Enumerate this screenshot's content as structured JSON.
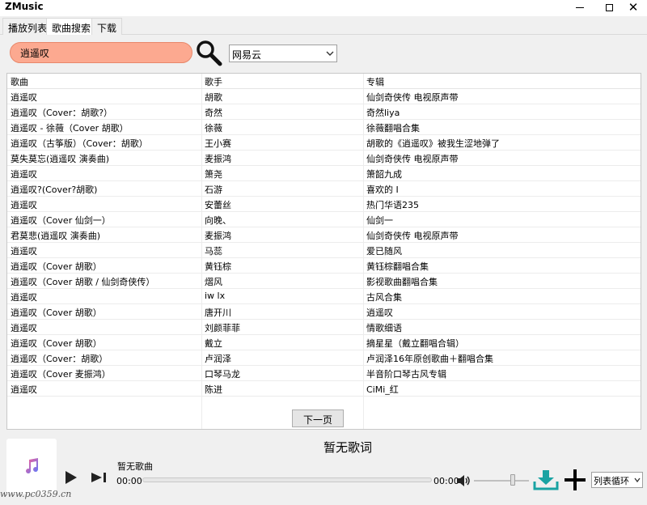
{
  "window": {
    "title": "ZMusic",
    "minimize_glyph": "—",
    "maximize_glyph": "☐",
    "close_glyph": "✕"
  },
  "tabs": [
    {
      "label": "播放列表",
      "active": false
    },
    {
      "label": "歌曲搜索",
      "active": true
    },
    {
      "label": "下载",
      "active": false
    }
  ],
  "search": {
    "value": "逍遥叹",
    "source": "网易云",
    "search_icon": "magnifier-icon"
  },
  "table": {
    "columns": [
      "歌曲",
      "歌手",
      "专辑"
    ],
    "rows": [
      [
        "逍遥叹",
        "胡歌",
        "仙剑奇侠传 电视原声带"
      ],
      [
        "逍遥叹（Cover：胡歌?）",
        "奇然",
        "奇然liya"
      ],
      [
        "逍遥叹 - 徐薇（Cover 胡歌）",
        "徐薇",
        "徐薇翻唱合集"
      ],
      [
        "逍遥叹（古筝版）（Cover：胡歌）",
        "王小赛",
        "胡歌的《逍遥叹》被我生涩地弹了"
      ],
      [
        "莫失莫忘(逍遥叹 演奏曲)",
        "麦振鸿",
        "仙剑奇侠传 电视原声带"
      ],
      [
        "逍遥叹",
        "箫尧",
        "箫韶九成"
      ],
      [
        "逍遥叹?(Cover?胡歌)",
        "石游",
        "喜欢的 I"
      ],
      [
        "逍遥叹",
        "安蕾丝",
        "热门华语235"
      ],
      [
        "逍遥叹（Cover 仙剑一）",
        "向晚、",
        "仙剑一"
      ],
      [
        "君莫悲(逍遥叹 演奏曲)",
        "麦振鸿",
        "仙剑奇侠传 电视原声带"
      ],
      [
        "逍遥叹",
        "马蕊",
        "爱已随风"
      ],
      [
        "逍遥叹（Cover 胡歌）",
        "黄钰棕",
        "黄钰棕翻唱合集"
      ],
      [
        "逍遥叹（Cover 胡歌 / 仙剑奇侠传）",
        "熠风",
        "影视歌曲翻唱合集"
      ],
      [
        "逍遥叹",
        "iw lx",
        "古风合集"
      ],
      [
        "逍遥叹（Cover 胡歌）",
        "唐开川",
        "逍遥叹"
      ],
      [
        "逍遥叹",
        "刘颜菲菲",
        "情歌细语"
      ],
      [
        "逍遥叹（Cover 胡歌）",
        "戴立",
        "摘星星（戴立翻唱合辑）"
      ],
      [
        "逍遥叹（Cover：胡歌）",
        "卢润泽",
        "卢润泽16年原创歌曲＋翻唱合集"
      ],
      [
        "逍遥叹（Cover 麦振鸿）",
        "口琴马龙",
        "半音阶口琴古风专辑"
      ],
      [
        "逍遥叹",
        "陈进",
        "CiMi_红"
      ]
    ],
    "next_page": "下一页"
  },
  "player": {
    "lyric": "暂无歌词",
    "song": "暂无歌曲",
    "time_current": "00:00",
    "time_total": "00:00",
    "progress": 0,
    "volume": 0.7,
    "mode": "列表循环",
    "icons": [
      "music-note-icon",
      "play-icon",
      "next-icon",
      "volume-icon",
      "download-icon",
      "add-icon"
    ]
  },
  "watermark": "www.pc0359.cn",
  "colors": {
    "search_pill": "#fca990",
    "accent_teal": "#1aa3a3",
    "note_gradient": [
      "#ff5d8f",
      "#5b7bff"
    ]
  }
}
